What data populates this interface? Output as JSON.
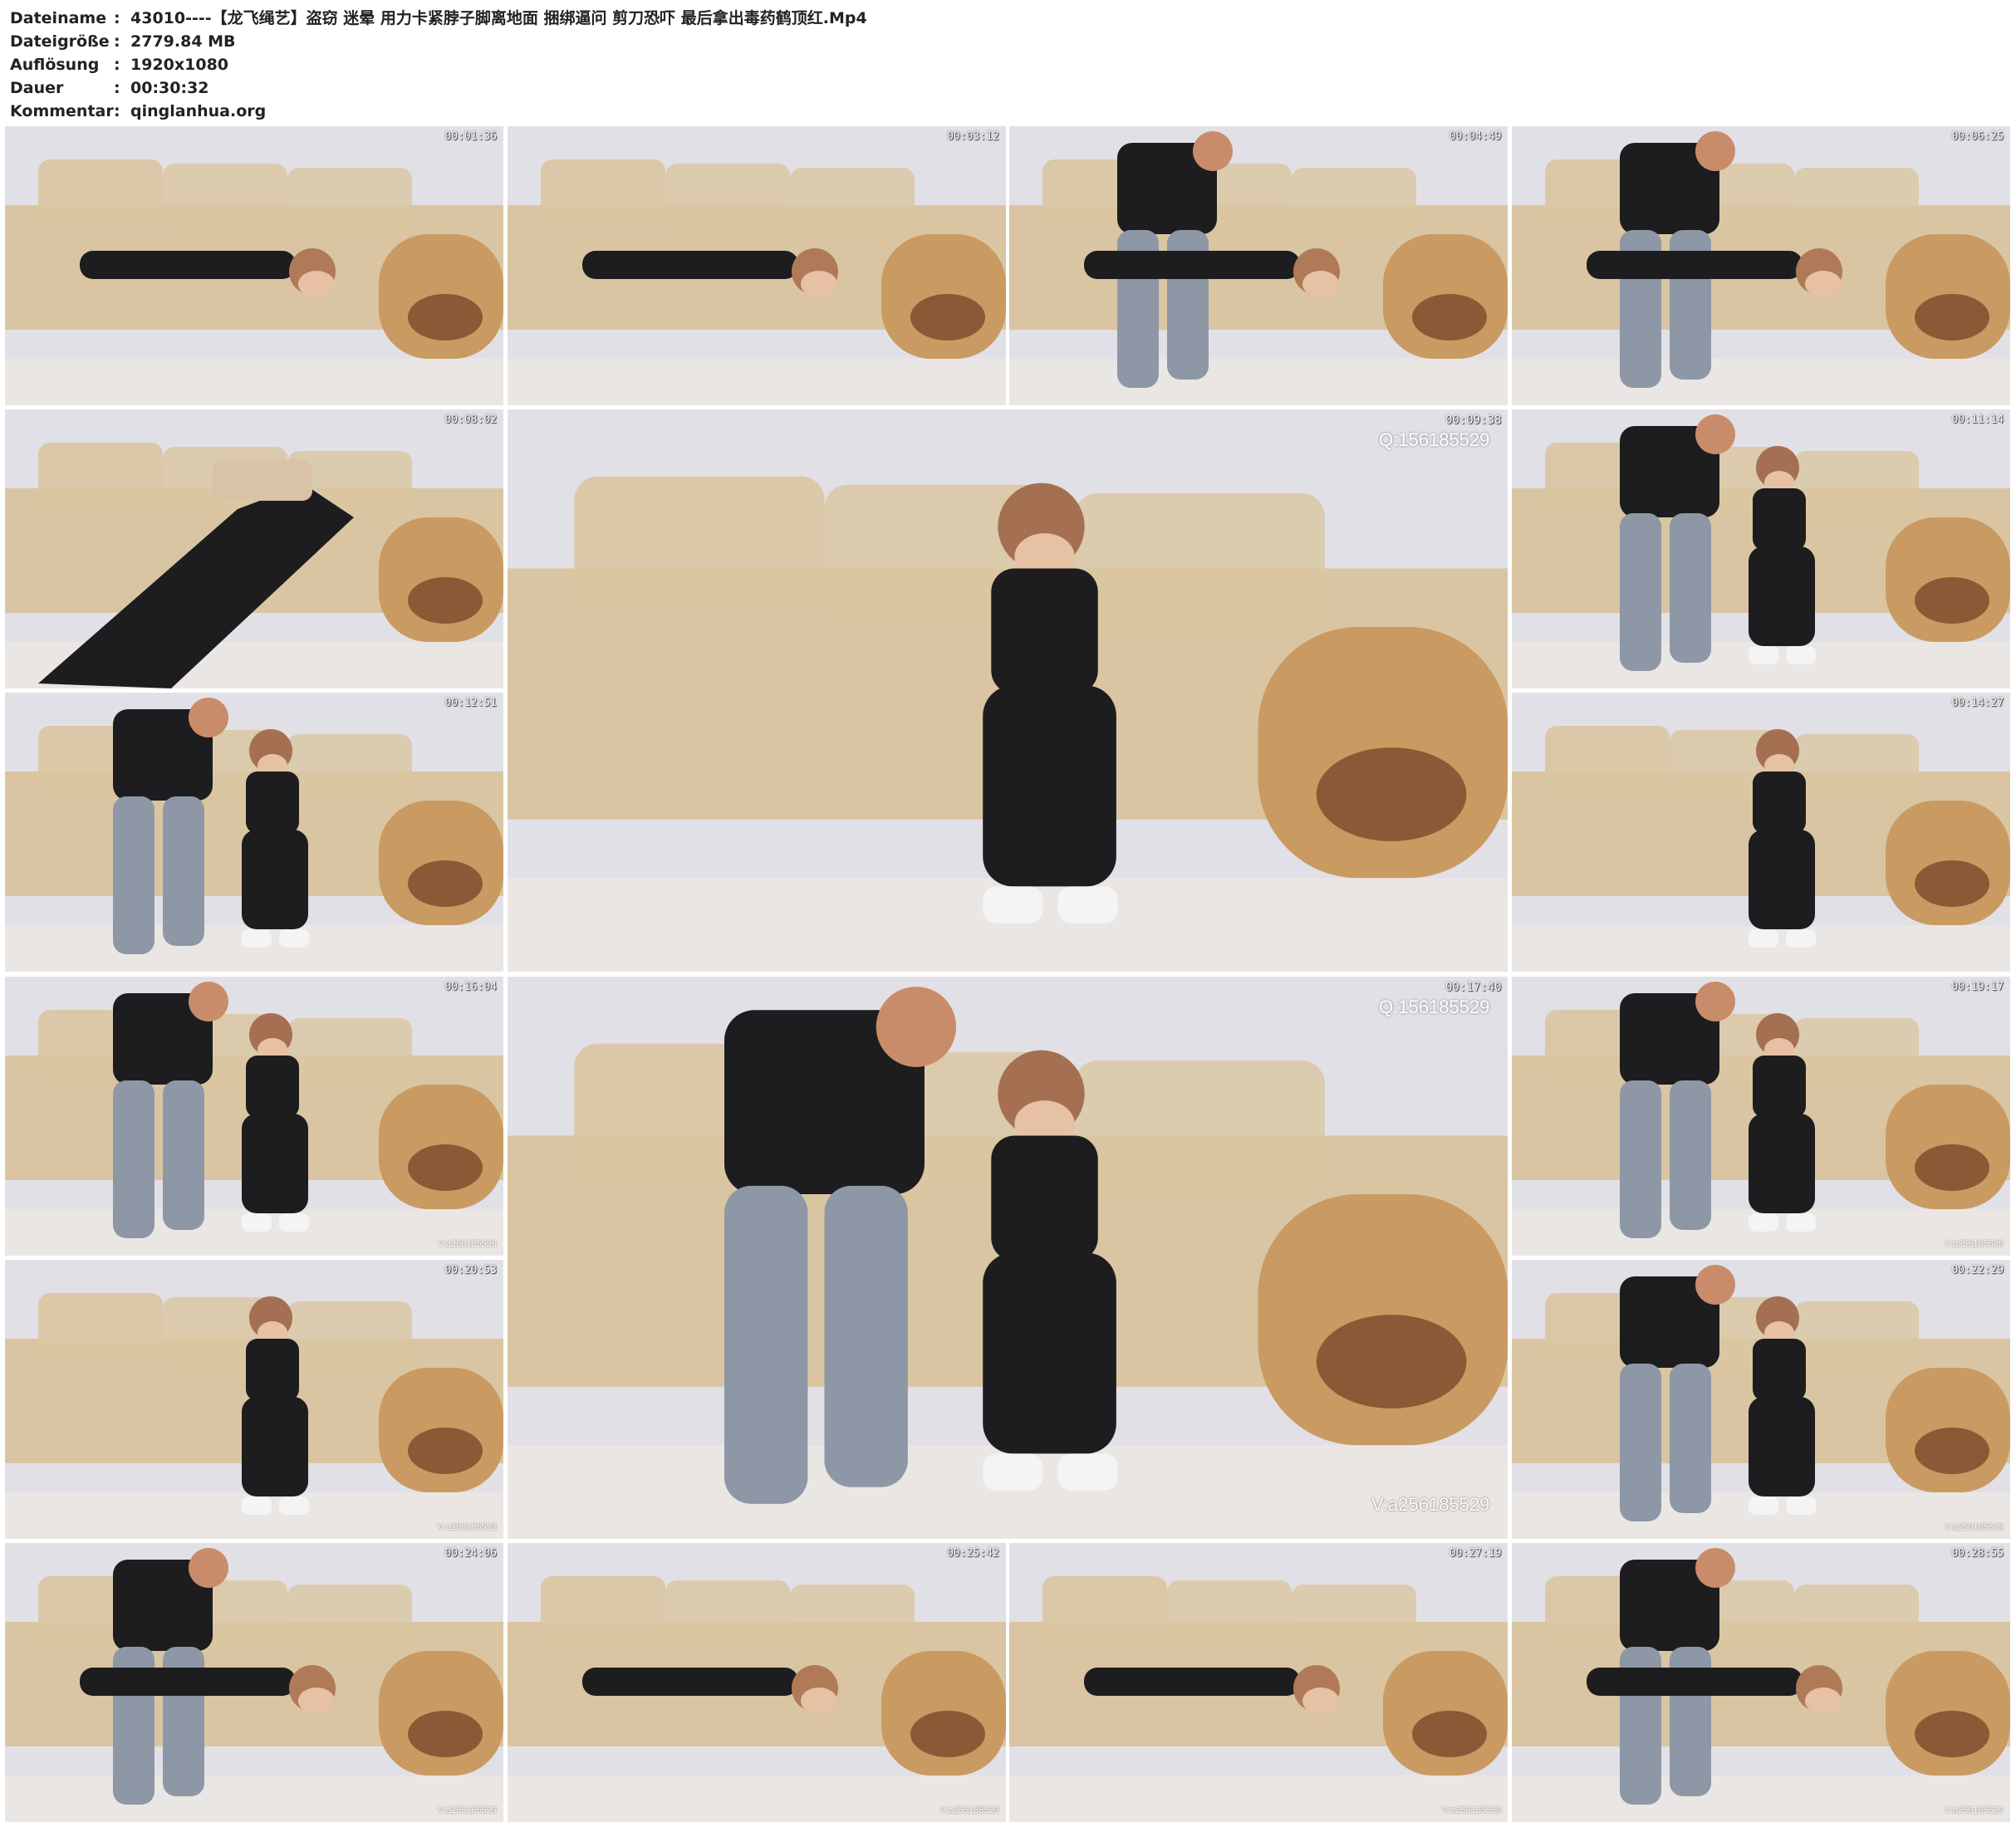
{
  "info": [
    {
      "label": "Dateiname",
      "value": "43010----【龙飞绳艺】盗窃 迷晕 用力卡紧脖子脚离地面 捆绑逼问 剪刀恐吓 最后拿出毒药鹤顶红.Mp4"
    },
    {
      "label": "Dateigröße",
      "value": "2779.84 MB"
    },
    {
      "label": "Auflösung",
      "value": "1920x1080"
    },
    {
      "label": "Dauer",
      "value": "00:30:32"
    },
    {
      "label": "Kommentar",
      "value": "qinglanhua.org"
    }
  ],
  "separator": ":",
  "thumbnails": [
    {
      "time": "00:01:36",
      "scene": "lying",
      "big": false,
      "q_watermark": "",
      "v_watermark": ""
    },
    {
      "time": "00:03:12",
      "scene": "lying",
      "big": false,
      "q_watermark": "",
      "v_watermark": ""
    },
    {
      "time": "00:04:49",
      "scene": "lying-man",
      "big": false,
      "q_watermark": "",
      "v_watermark": ""
    },
    {
      "time": "00:06:25",
      "scene": "lying-man",
      "big": false,
      "q_watermark": "",
      "v_watermark": ""
    },
    {
      "time": "00:08:02",
      "scene": "closeup",
      "big": false,
      "q_watermark": "",
      "v_watermark": ""
    },
    {
      "time": "00:09:38",
      "scene": "sitting-room",
      "big": true,
      "q_watermark": "Q:156185529",
      "v_watermark": ""
    },
    {
      "time": "00:11:14",
      "scene": "room-wide",
      "big": false,
      "q_watermark": "",
      "v_watermark": ""
    },
    {
      "time": "00:12:51",
      "scene": "sitting-man",
      "big": false,
      "q_watermark": "",
      "v_watermark": ""
    },
    {
      "time": "00:14:27",
      "scene": "sitting",
      "big": false,
      "q_watermark": "",
      "v_watermark": ""
    },
    {
      "time": "00:16:04",
      "scene": "sitting-man",
      "big": false,
      "q_watermark": "",
      "v_watermark": "V:a256185529"
    },
    {
      "time": "00:17:40",
      "scene": "sitting-man",
      "big": true,
      "q_watermark": "Q:156185529",
      "v_watermark": "V:a256185529"
    },
    {
      "time": "00:19:17",
      "scene": "sitting-man",
      "big": false,
      "q_watermark": "",
      "v_watermark": "V:a256185529"
    },
    {
      "time": "00:20:53",
      "scene": "sitting",
      "big": false,
      "q_watermark": "",
      "v_watermark": "V:a256185529"
    },
    {
      "time": "00:22:29",
      "scene": "sitting-man",
      "big": false,
      "q_watermark": "",
      "v_watermark": "V:a256185529"
    },
    {
      "time": "00:24:06",
      "scene": "lying-man",
      "big": false,
      "q_watermark": "",
      "v_watermark": "V:a256185529"
    },
    {
      "time": "00:25:42",
      "scene": "hogtied",
      "big": false,
      "q_watermark": "",
      "v_watermark": "V:a256185529"
    },
    {
      "time": "00:27:19",
      "scene": "hogtied",
      "big": false,
      "q_watermark": "",
      "v_watermark": "V:a256185529"
    },
    {
      "time": "00:28:55",
      "scene": "hogtied-man",
      "big": false,
      "q_watermark": "",
      "v_watermark": "V:a256185529"
    }
  ],
  "colors": {
    "wall": "#e2e0e7",
    "sofa": "#d9c5a1",
    "sofa_leather": "#c99a62",
    "clothing": "#1d1d1f",
    "jeans": "#8d97a6",
    "floor": "#eae6e3"
  }
}
